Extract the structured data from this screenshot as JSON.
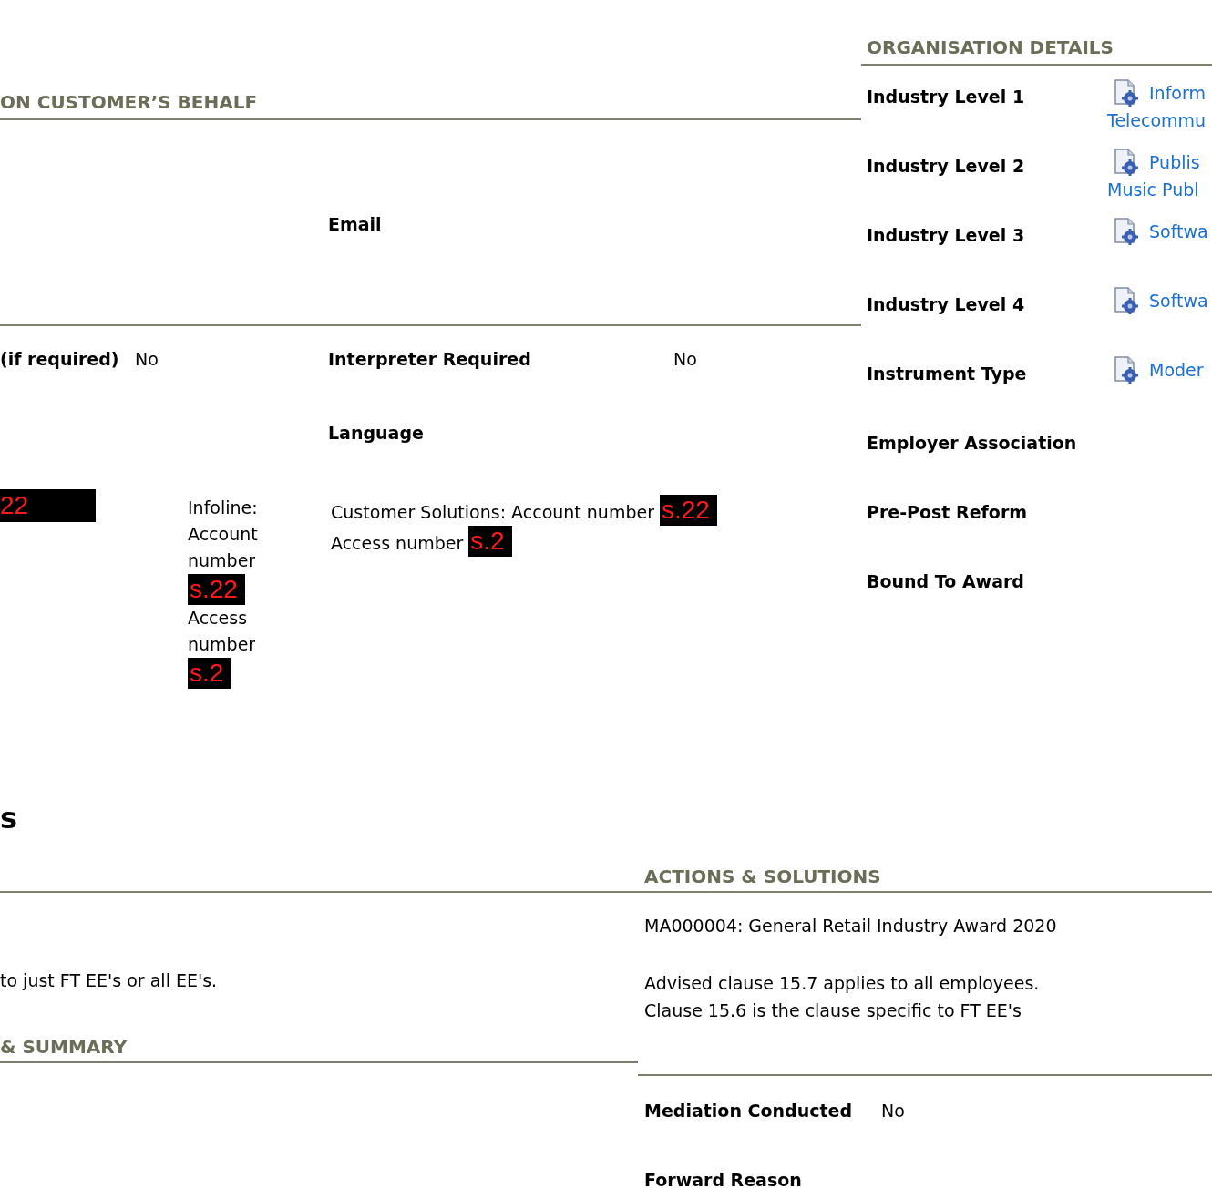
{
  "customer_section": {
    "heading": "ON CUSTOMER’S BEHALF",
    "email_label": "Email",
    "interpreter_row": [
      {
        "kind": "label",
        "text": "(if required)"
      },
      {
        "kind": "value",
        "text": "No"
      },
      {
        "kind": "label",
        "text": "Interpreter Required"
      },
      {
        "kind": "value",
        "text": "No"
      }
    ],
    "language_label": "Language",
    "contact_row": {
      "redaction": "22",
      "infoline": [
        {
          "kind": "text",
          "text": "Infoline: Account number"
        },
        {
          "kind": "redaction",
          "text": "s.22"
        },
        {
          "kind": "text",
          "text": "Access number"
        },
        {
          "kind": "redaction",
          "text": "s.2"
        }
      ],
      "customer_solutions": [
        {
          "kind": "text",
          "text": "Customer Solutions: Account number"
        },
        {
          "kind": "redaction",
          "text": "s.22"
        },
        {
          "kind": "text",
          "text": "Access number"
        },
        {
          "kind": "redaction",
          "text": "s.2"
        }
      ]
    }
  },
  "organisation_details": {
    "heading": "ORGANISATION DETAILS",
    "fields": [
      {
        "label": "Industry Level 1",
        "value": [
          "Inform",
          "Telecommu"
        ]
      },
      {
        "label": "Industry Level 2",
        "value": [
          "Publis",
          "Music Publ"
        ]
      },
      {
        "label": "Industry Level 3",
        "value": [
          "Softwa"
        ]
      },
      {
        "label": "Industry Level 4",
        "value": [
          "Softwa"
        ]
      },
      {
        "label": "Instrument Type",
        "value": [
          "Moder"
        ]
      },
      {
        "label": "Employer Association"
      },
      {
        "label": "Pre-Post Reform"
      },
      {
        "label": "Bound To Award"
      }
    ]
  },
  "section_heading": "s",
  "question_text": "to just FT EE's or all EE's.",
  "summary_heading": "& SUMMARY",
  "actions": {
    "heading": "ACTIONS & SOLUTIONS",
    "award": "MA000004: General Retail Industry Award 2020",
    "advice": [
      "Advised clause 15.7 applies to all employees.",
      "Clause 15.6 is the clause specific to FT EE's"
    ],
    "fields": [
      {
        "label": "Mediation Conducted",
        "value": "No"
      },
      {
        "label": "Forward Reason"
      }
    ]
  }
}
